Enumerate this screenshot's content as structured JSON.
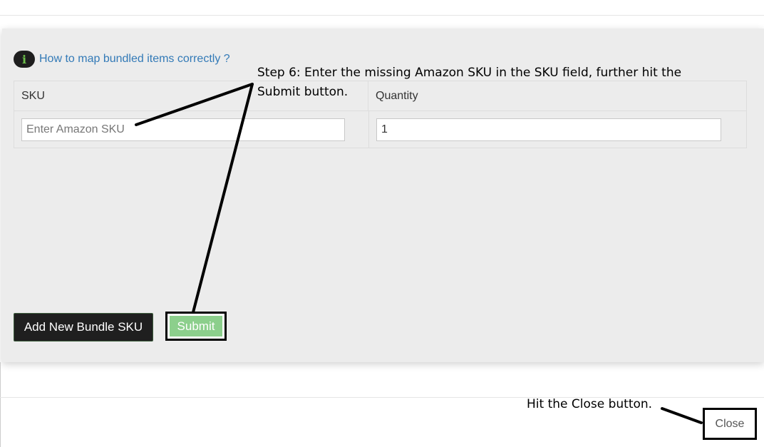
{
  "help": {
    "link_text": "How to map bundled items correctly ?",
    "icon": "info-icon"
  },
  "table": {
    "headers": [
      "SKU",
      "Quantity"
    ],
    "sku_placeholder": "Enter Amazon SKU",
    "sku_value": "",
    "quantity_value": "1"
  },
  "actions": {
    "add_bundle_label": "Add New Bundle SKU",
    "submit_label": "Submit"
  },
  "footer": {
    "close_label": "Close"
  },
  "annotations": {
    "step6": "Step 6: Enter the missing Amazon SKU in the SKU field, further hit the Submit button.",
    "close_hint": "Hit the Close button."
  },
  "colors": {
    "link": "#337ab7",
    "submit_bg": "#8ccf8c",
    "add_button_bg": "#1f1f1f",
    "panel_bg": "#ececec",
    "info_icon_glyph": "#6cc04a"
  }
}
